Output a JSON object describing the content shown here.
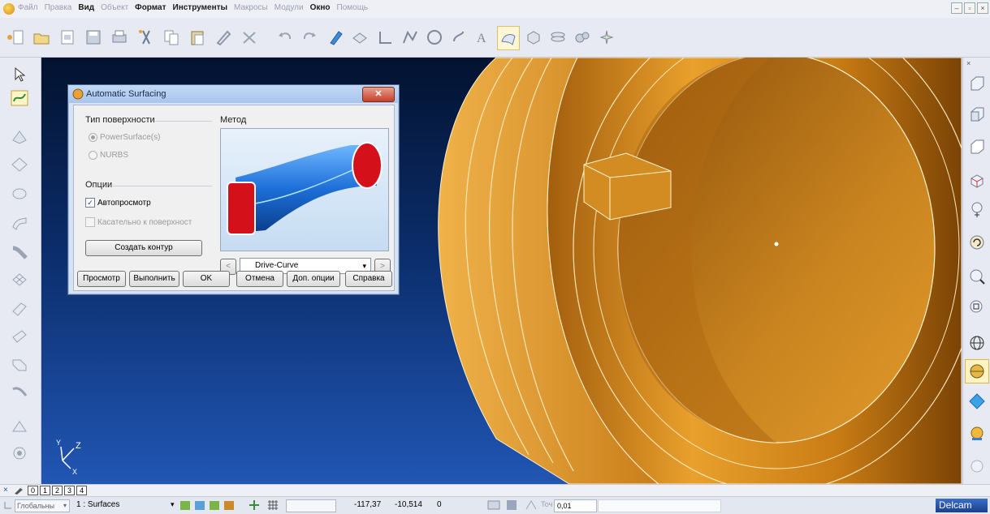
{
  "menubar": {
    "items": [
      {
        "label": "Файл",
        "active": false
      },
      {
        "label": "Правка",
        "active": false
      },
      {
        "label": "Вид",
        "active": true
      },
      {
        "label": "Объект",
        "active": false
      },
      {
        "label": "Формат",
        "active": true
      },
      {
        "label": "Инструменты",
        "active": true
      },
      {
        "label": "Макросы",
        "active": false
      },
      {
        "label": "Модули",
        "active": false
      },
      {
        "label": "Окно",
        "active": true
      },
      {
        "label": "Помощь",
        "active": false
      }
    ],
    "window_controls": [
      "–",
      "▫",
      "×"
    ]
  },
  "toolbar": {
    "icons": [
      "new-file-icon",
      "open-folder-icon",
      "import-icon",
      "save-icon",
      "print-icon",
      "cut-icon",
      "copy-icon",
      "paste-icon",
      "pencil-icon",
      "delete-icon",
      "undo-icon",
      "redo-icon",
      "highlight-icon",
      "layers-icon",
      "line-icon",
      "curve-icon",
      "circle-icon",
      "spline-icon",
      "text-icon",
      "surface-icon",
      "solid-icon",
      "stack-icon",
      "gears-icon",
      "sparkle-icon"
    ]
  },
  "dialog": {
    "title": "Automatic Surfacing",
    "close_label": "✕",
    "surface_type_heading": "Тип поверхности",
    "options": {
      "powersurface_label": "PowerSurface(s)",
      "nurbs_label": "NURBS"
    },
    "options_heading": "Опции",
    "autopreview_label": "Автопросмотр",
    "tangent_label": "Касательно к поверхност",
    "create_contour_label": "Создать контур",
    "method_heading": "Метод",
    "method_value": "Drive-Curve",
    "nav_prev": "<",
    "nav_next": ">",
    "dropdown_arrow": "▾",
    "buttons": {
      "preview": "Просмотр",
      "execute": "Выполнить",
      "ok": "OK",
      "cancel": "Отмена",
      "more_options": "Доп. опции",
      "help": "Справка"
    }
  },
  "viewport": {
    "axis_z": "Z",
    "axis_y": "Y",
    "axis_x": "X"
  },
  "status_tabs": [
    "0",
    "1",
    "2",
    "3",
    "4"
  ],
  "statusbar": {
    "workplane": "Глобальны",
    "level": "1 : Surfaces",
    "x": "-117,37",
    "y": "-10,514",
    "z": "0",
    "tolerance_label": "Точ",
    "tolerance": "0,01",
    "brand": "Delcam"
  },
  "colors": {
    "part": "#d88a1e",
    "background_top": "#03122f",
    "background_bottom": "#2156b4",
    "brand": "#1e4ea0"
  }
}
